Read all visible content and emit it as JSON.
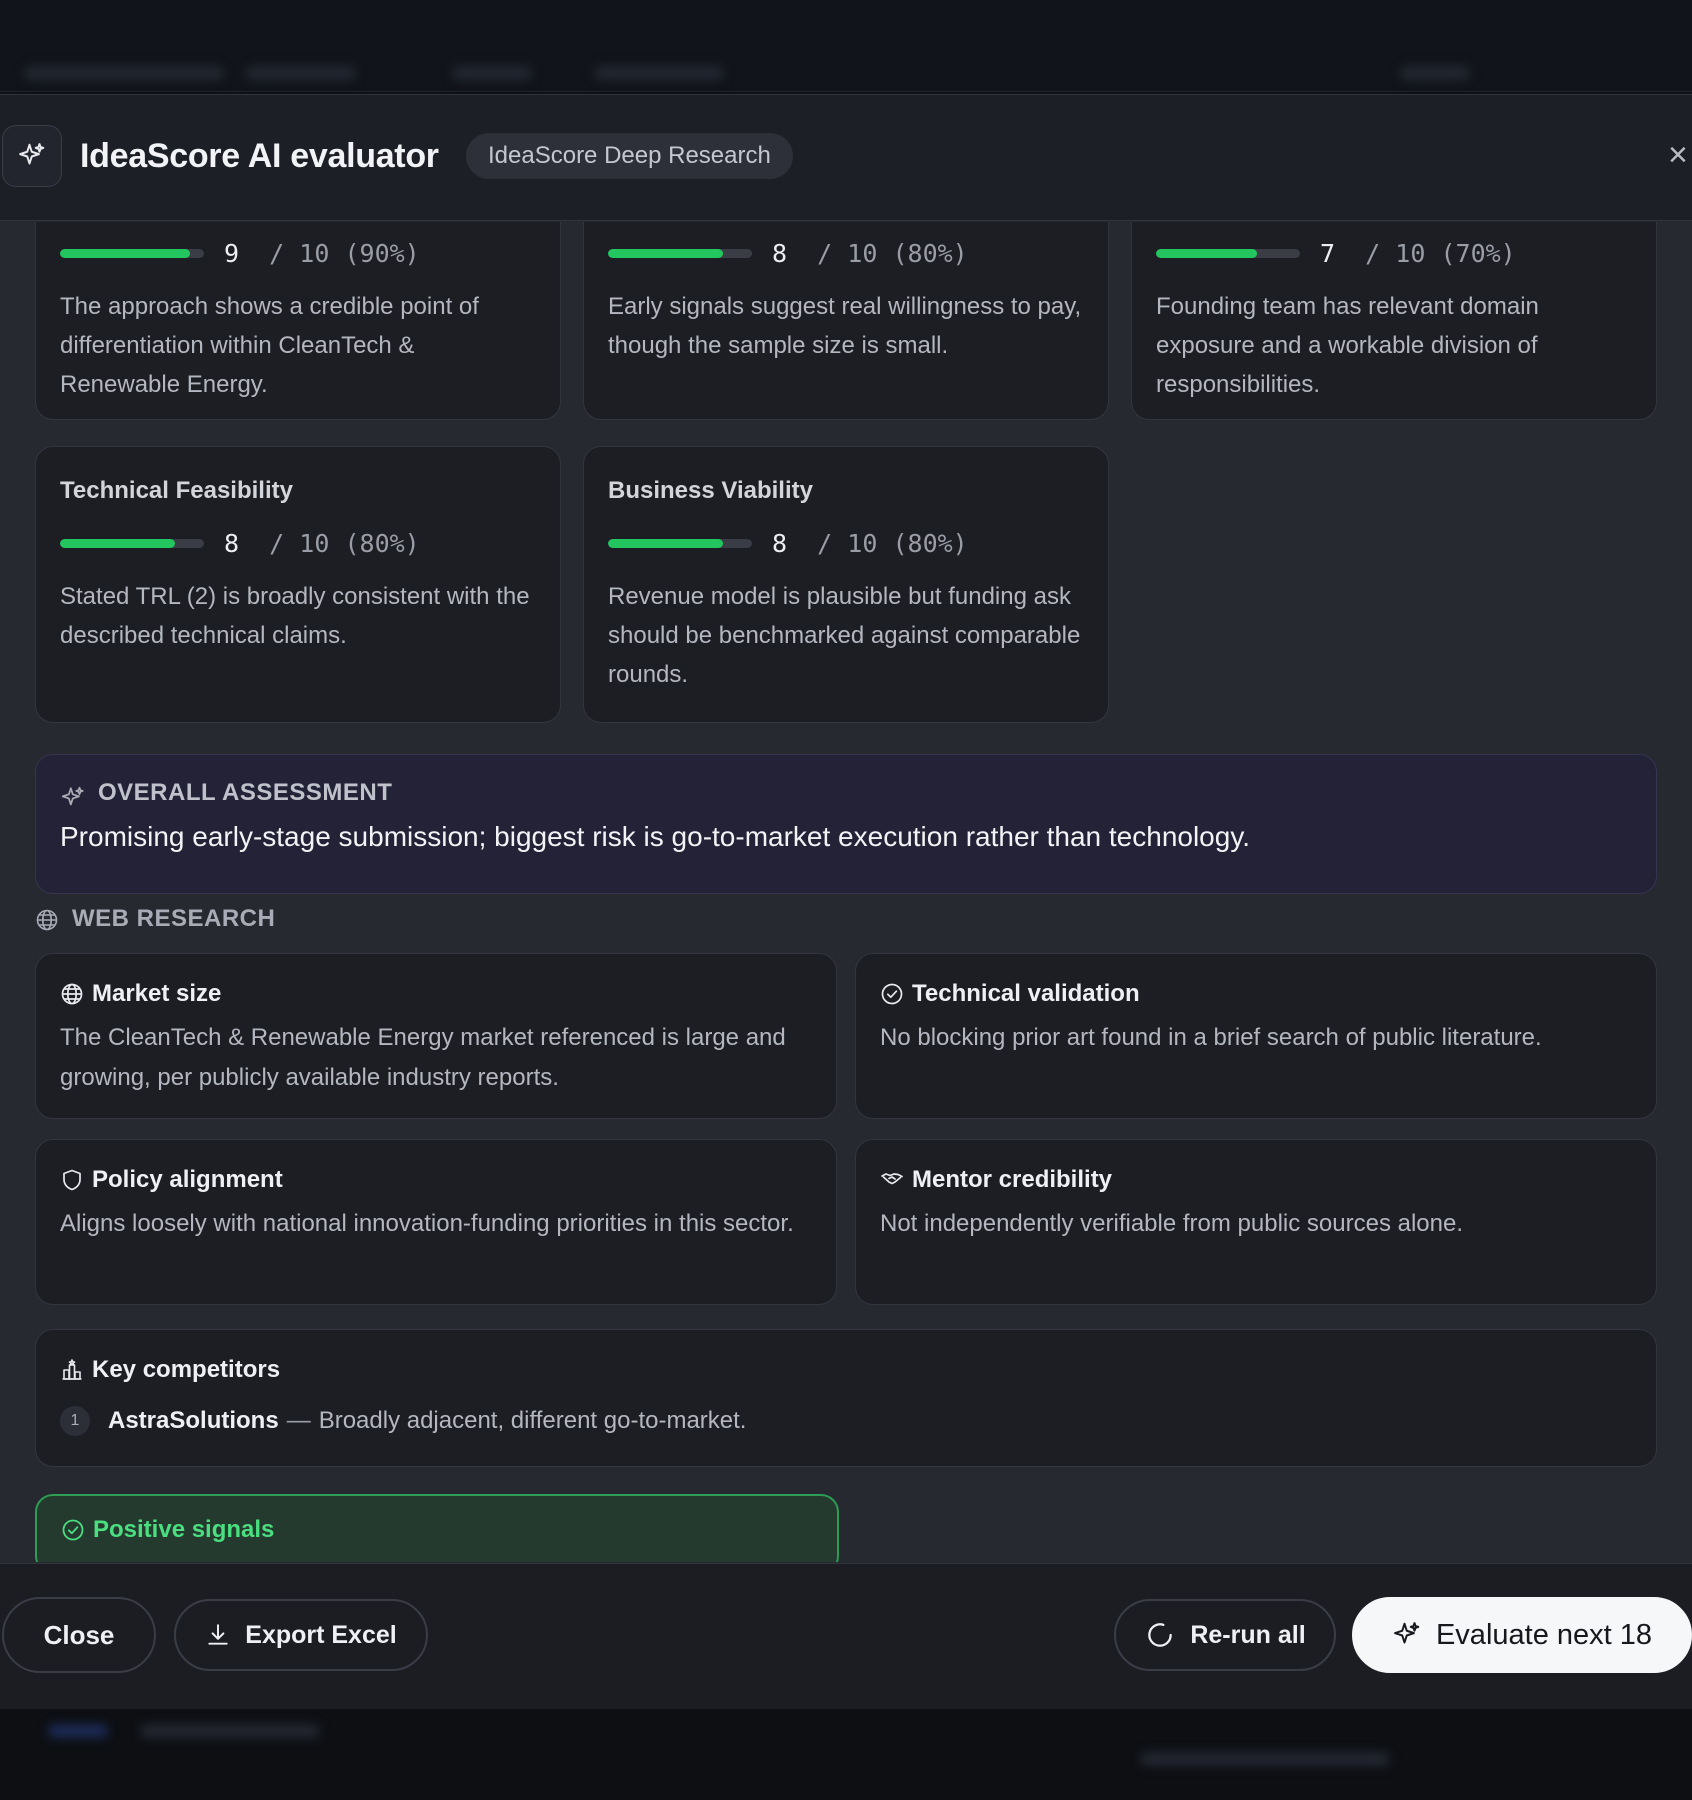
{
  "modal": {
    "title": "IdeaScore AI evaluator",
    "badge": "IdeaScore Deep Research",
    "close_icon": "×"
  },
  "criteria": [
    {
      "title": "",
      "score": 9,
      "max": 10,
      "percent": 90,
      "sep": "/",
      "max_label": "10",
      "pct_label": "(90%)",
      "description": "The approach shows a credible point of differentiation within CleanTech & Renewable Energy."
    },
    {
      "title": "",
      "score": 8,
      "max": 10,
      "percent": 80,
      "sep": "/",
      "max_label": "10",
      "pct_label": "(80%)",
      "description": "Early signals suggest real willingness to pay, though the sample size is small."
    },
    {
      "title": "",
      "score": 7,
      "max": 10,
      "percent": 70,
      "sep": "/",
      "max_label": "10",
      "pct_label": "(70%)",
      "description": "Founding team has relevant domain exposure and a workable division of responsibilities."
    },
    {
      "title": "Technical Feasibility",
      "score": 8,
      "max": 10,
      "percent": 80,
      "sep": "/",
      "max_label": "10",
      "pct_label": "(80%)",
      "description": "Stated TRL (2) is broadly consistent with the described technical claims."
    },
    {
      "title": "Business Viability",
      "score": 8,
      "max": 10,
      "percent": 80,
      "sep": "/",
      "max_label": "10",
      "pct_label": "(80%)",
      "description": "Revenue model is plausible but funding ask should be benchmarked against comparable rounds."
    }
  ],
  "overall": {
    "label": "OVERALL ASSESSMENT",
    "text": "Promising early-stage submission; biggest risk is go-to-market execution rather than technology."
  },
  "web_research": {
    "label": "WEB RESEARCH",
    "items": [
      {
        "title": "Market size",
        "icon": "globe-icon",
        "description": "The CleanTech & Renewable Energy market referenced is large and growing, per publicly available industry reports."
      },
      {
        "title": "Technical validation",
        "icon": "check-circle-icon",
        "description": "No blocking prior art found in a brief search of public literature."
      },
      {
        "title": "Policy alignment",
        "icon": "shield-icon",
        "description": "Aligns loosely with national innovation-funding priorities in this sector."
      },
      {
        "title": "Mentor credibility",
        "icon": "handshake-icon",
        "description": "Not independently verifiable from public sources alone."
      }
    ]
  },
  "competitors": {
    "title": "Key competitors",
    "items": [
      {
        "num": "1",
        "name": "AstraSolutions",
        "sep": "—",
        "description": "Broadly adjacent, different go-to-market."
      }
    ]
  },
  "positive_signals": {
    "label": "Positive signals"
  },
  "footer": {
    "close_label": "Close",
    "export_label": "Export Excel",
    "rerun_label": "Re-run all",
    "evaluate_label": "Evaluate next 18"
  },
  "colors": {
    "accent_green": "#22c55e",
    "positive_text": "#4ade80",
    "overall_bg": "#242236"
  }
}
